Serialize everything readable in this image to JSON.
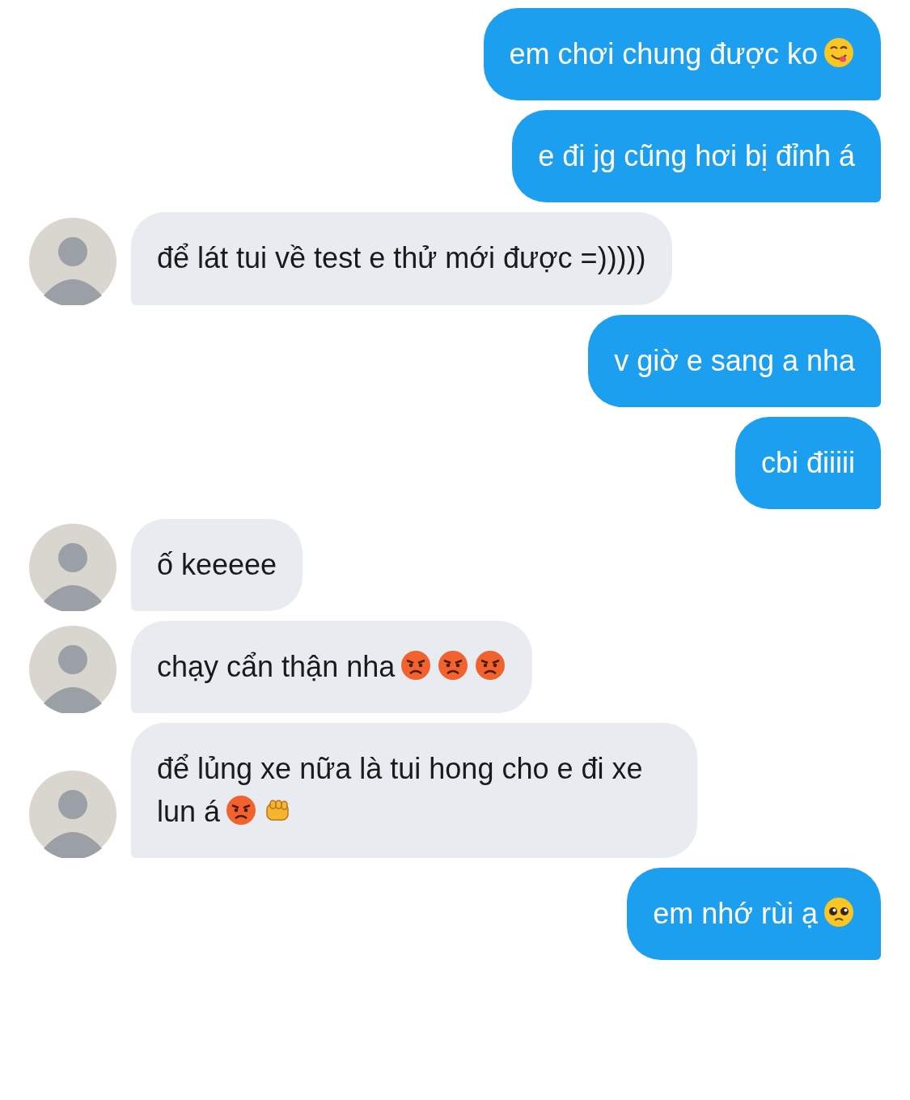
{
  "messages": [
    {
      "kind": "outgoing",
      "text": "em chơi chung được ko",
      "emojis": [
        {
          "kind": "yum"
        }
      ]
    },
    {
      "kind": "outgoing",
      "text": "e đi jg cũng hơi bị đỉnh á"
    },
    {
      "kind": "incoming",
      "text": "để lát tui về test e thử mới được =)))))"
    },
    {
      "kind": "outgoing",
      "text": "v giờ e sang a nha"
    },
    {
      "kind": "outgoing",
      "text": "cbi điiiii"
    },
    {
      "kind": "incoming",
      "text": "ố keeeee"
    },
    {
      "kind": "incoming",
      "text": "chạy cẩn thận nha",
      "emojis": [
        {
          "kind": "angry"
        },
        {
          "kind": "angry"
        },
        {
          "kind": "angry"
        }
      ]
    },
    {
      "kind": "incoming",
      "text": "để lủng xe nữa là tui hong cho e đi xe lun á",
      "emojis": [
        {
          "kind": "angry"
        },
        {
          "kind": "fist"
        }
      ]
    },
    {
      "kind": "outgoing",
      "text": "em nhớ rùi ạ",
      "emojis": [
        {
          "kind": "pleading"
        }
      ]
    }
  ]
}
